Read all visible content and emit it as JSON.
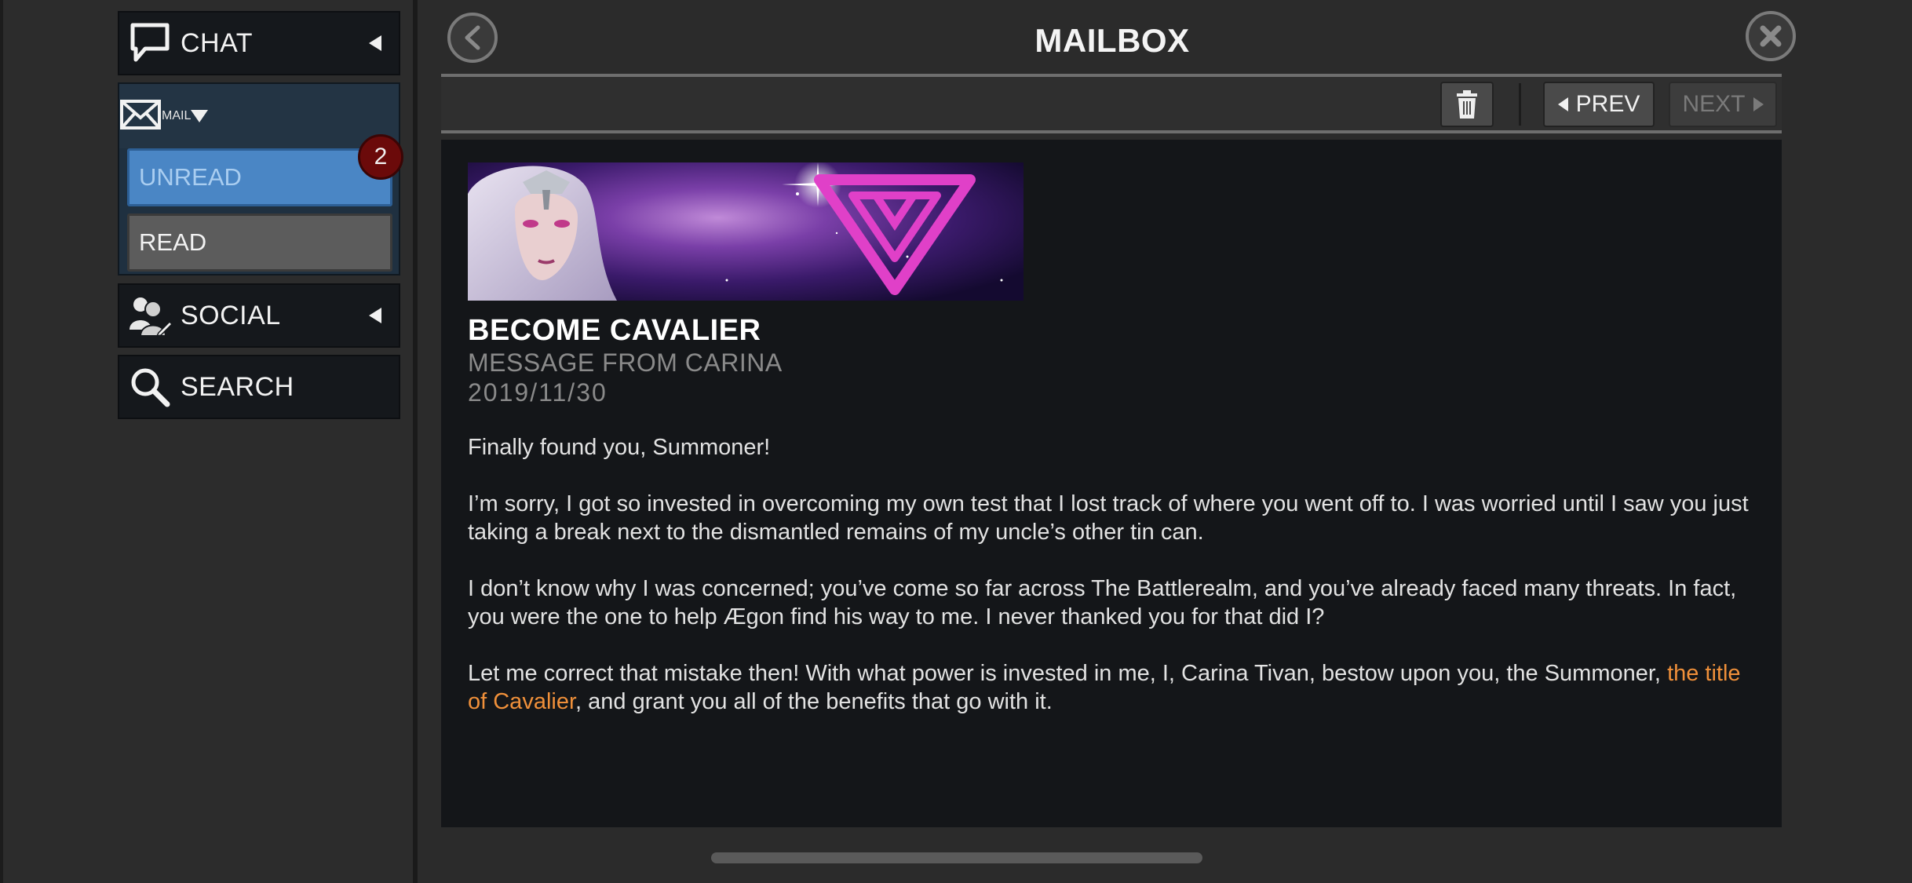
{
  "sidebar": {
    "chat": {
      "label": "CHAT",
      "icon": "speech-bubble-icon"
    },
    "mail": {
      "label": "MAIL",
      "icon": "envelope-icon",
      "unread_label": "UNREAD",
      "unread_count": "2",
      "read_label": "READ"
    },
    "social": {
      "label": "SOCIAL",
      "icon": "people-icon"
    },
    "search": {
      "label": "SEARCH",
      "icon": "magnifier-icon"
    }
  },
  "header": {
    "title": "MAILBOX",
    "back_icon": "chevron-left-icon",
    "close_icon": "close-icon"
  },
  "toolbar": {
    "delete_icon": "trash-icon",
    "prev_label": "PREV",
    "next_label": "NEXT"
  },
  "message": {
    "title": "BECOME CAVALIER",
    "from": "MESSAGE FROM CARINA",
    "date": "2019/11/30",
    "p1": "Finally found you, Summoner!",
    "p2": "I’m sorry, I got so invested in overcoming my own test that I lost track of where you went off to. I was worried until I saw you just taking a break next to the dismantled remains of my uncle’s other tin can.",
    "p3": "I don’t know why I was concerned; you’ve come so far across The Battlerealm, and you’ve already faced many threats. In fact, you were the one to help Ægon find his way to me. I never thanked you for that did I?",
    "p4_before": "Let me correct that mistake then! With what power is invested in me, I, Carina Tivan, bestow upon you, the Summoner, ",
    "p4_link": "the title of Cavalier",
    "p4_after": ", and grant you all of the benefits that go with it."
  },
  "colors": {
    "accent_blue": "#4a86c5",
    "link_orange": "#f0903a",
    "badge_red": "#6b0a0a"
  }
}
